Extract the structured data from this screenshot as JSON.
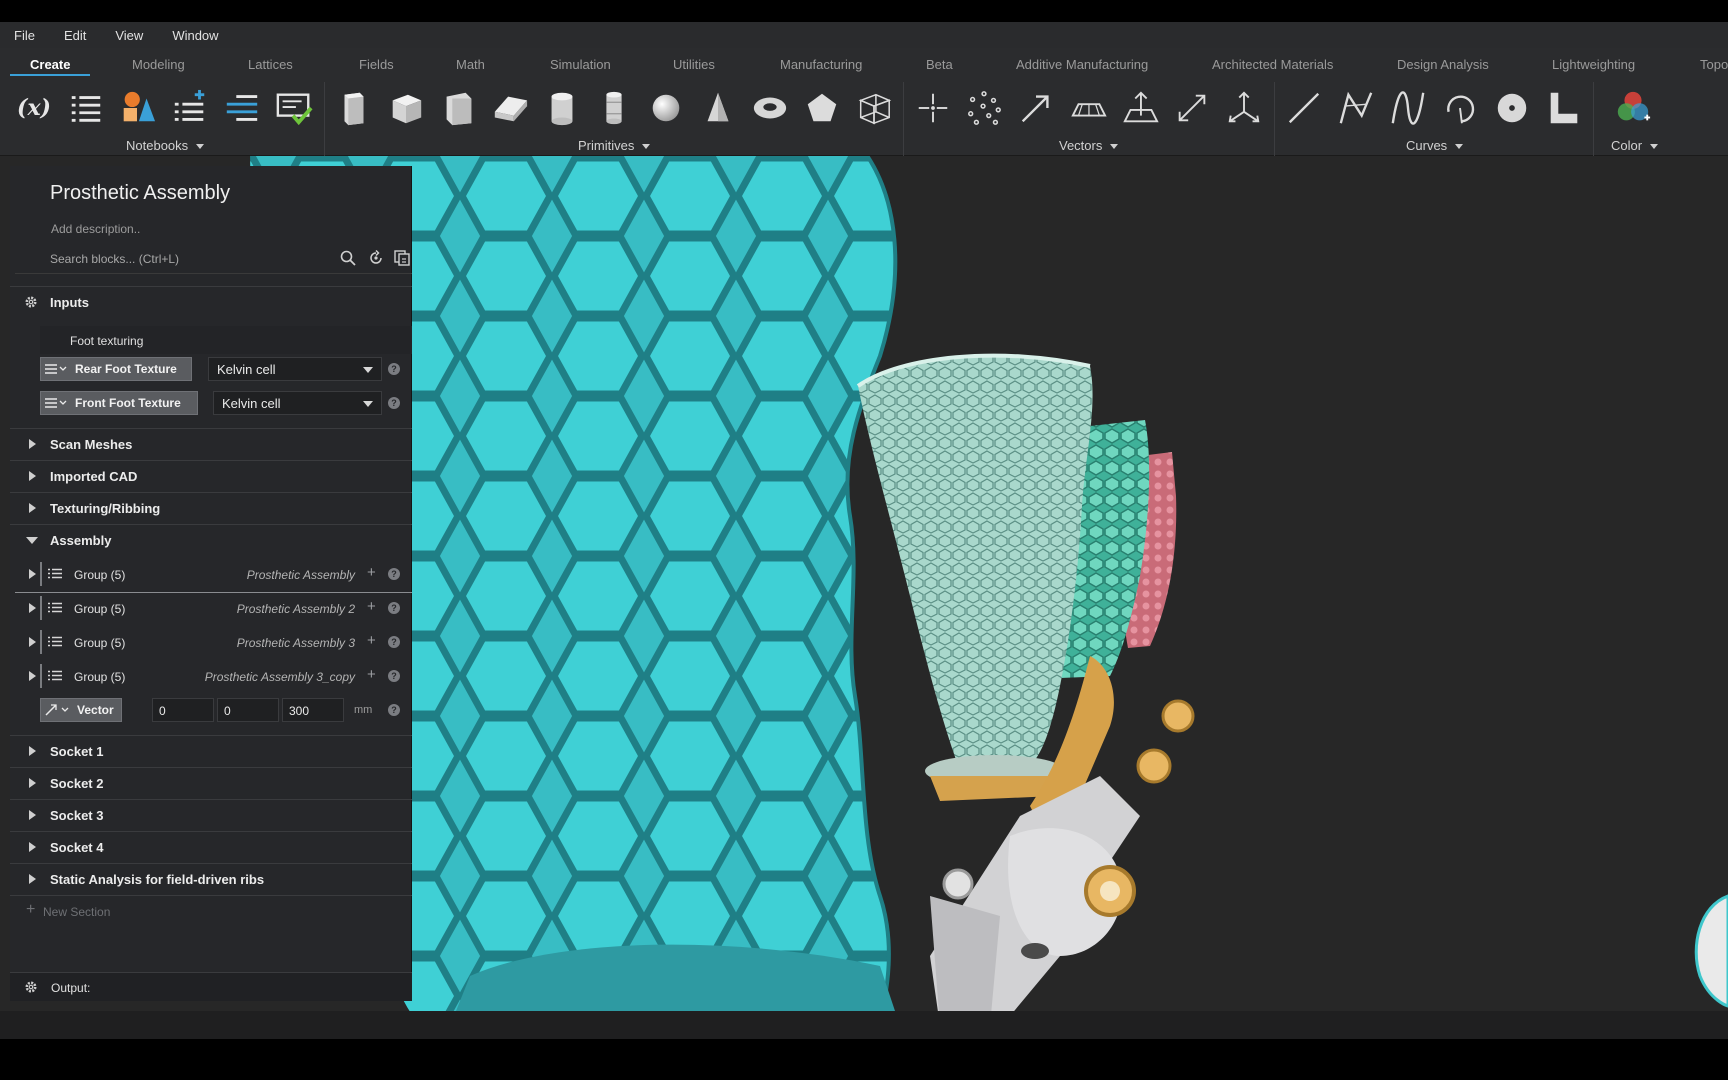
{
  "menubar": {
    "items": [
      "File",
      "Edit",
      "View",
      "Window"
    ]
  },
  "ribbon": {
    "tabs": [
      "Create",
      "Modeling",
      "Lattices",
      "Fields",
      "Math",
      "Simulation",
      "Utilities",
      "Manufacturing",
      "Beta",
      "Additive Manufacturing",
      "Architected Materials",
      "Design Analysis",
      "Lightweighting",
      "Topo"
    ],
    "active_tab": "Create",
    "groups": {
      "notebooks": "Notebooks",
      "primitives": "Primitives",
      "vectors": "Vectors",
      "curves": "Curves",
      "color": "Color"
    },
    "variable_glyph": "(x)"
  },
  "colors": {
    "accent": "#3aa0d8",
    "teal": "#3fc7cc",
    "viewport": "#272727"
  },
  "panel": {
    "title": "Prosthetic Assembly",
    "description": "Add description..",
    "search_placeholder": "Search blocks... (Ctrl+L)",
    "inputs": {
      "label": "Inputs",
      "subheading": "Foot texturing",
      "rear": {
        "label": "Rear Foot Texture",
        "value": "Kelvin cell"
      },
      "front": {
        "label": "Front Foot Texture",
        "value": "Kelvin cell"
      }
    },
    "sections_top": [
      "Scan Meshes",
      "Imported CAD",
      "Texturing/Ribbing"
    ],
    "assembly": {
      "label": "Assembly",
      "groups": [
        {
          "label": "Group (5)",
          "name": "Prosthetic Assembly"
        },
        {
          "label": "Group (5)",
          "name": "Prosthetic Assembly 2"
        },
        {
          "label": "Group (5)",
          "name": "Prosthetic Assembly 3"
        },
        {
          "label": "Group (5)",
          "name": "Prosthetic Assembly 3_copy"
        }
      ],
      "vector": {
        "label": "Vector",
        "x": "0",
        "y": "0",
        "z": "300",
        "unit": "mm"
      }
    },
    "sections_bottom": [
      "Socket 1",
      "Socket 2",
      "Socket 3",
      "Socket 4",
      "Static Analysis for field-driven ribs"
    ],
    "new_section": "New Section",
    "output": "Output:"
  }
}
